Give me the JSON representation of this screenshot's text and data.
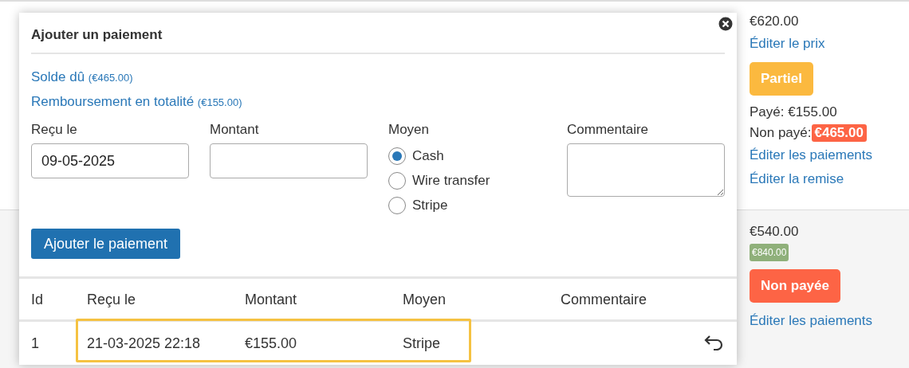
{
  "modal": {
    "title": "Ajouter un paiement",
    "links": [
      {
        "label": "Solde dû",
        "amount": "(€465.00)"
      },
      {
        "label": "Remboursement en totalité",
        "amount": "(€155.00)"
      }
    ],
    "fields": [
      {
        "kind": "date",
        "label": "Reçu le",
        "value": "09-05-2025"
      },
      {
        "kind": "text",
        "label": "Montant"
      },
      {
        "kind": "radio",
        "label": "Moyen",
        "options": [
          {
            "label": "Cash",
            "selected": true
          },
          {
            "label": "Wire transfer",
            "selected": false
          },
          {
            "label": "Stripe",
            "selected": false
          }
        ]
      },
      {
        "kind": "textarea",
        "label": "Commentaire"
      }
    ],
    "submit": "Ajouter le paiement",
    "table": {
      "columns": [
        "Id",
        "Reçu le",
        "Montant",
        "Moyen",
        "Commentaire"
      ],
      "rows": [
        {
          "cells": [
            "1",
            "21-03-2025 22:18",
            "€155.00",
            "Stripe",
            ""
          ],
          "highlighted": true
        }
      ]
    }
  },
  "orders": [
    {
      "price": "€620.00",
      "edit_price": "Éditer le prix",
      "status": {
        "label": "Partiel",
        "color": "#fbb93f"
      },
      "paid": "Payé: €155.00",
      "unpaid_label": "Non payé:",
      "unpaid_amount": "€465.00",
      "links": [
        "Éditer les paiements",
        "Éditer la remise"
      ]
    },
    {
      "price": "€540.00",
      "old_price": "€840.00",
      "status": {
        "label": "Non payée",
        "color": "#fd6445"
      },
      "links": [
        "Éditer les paiements"
      ]
    }
  ]
}
